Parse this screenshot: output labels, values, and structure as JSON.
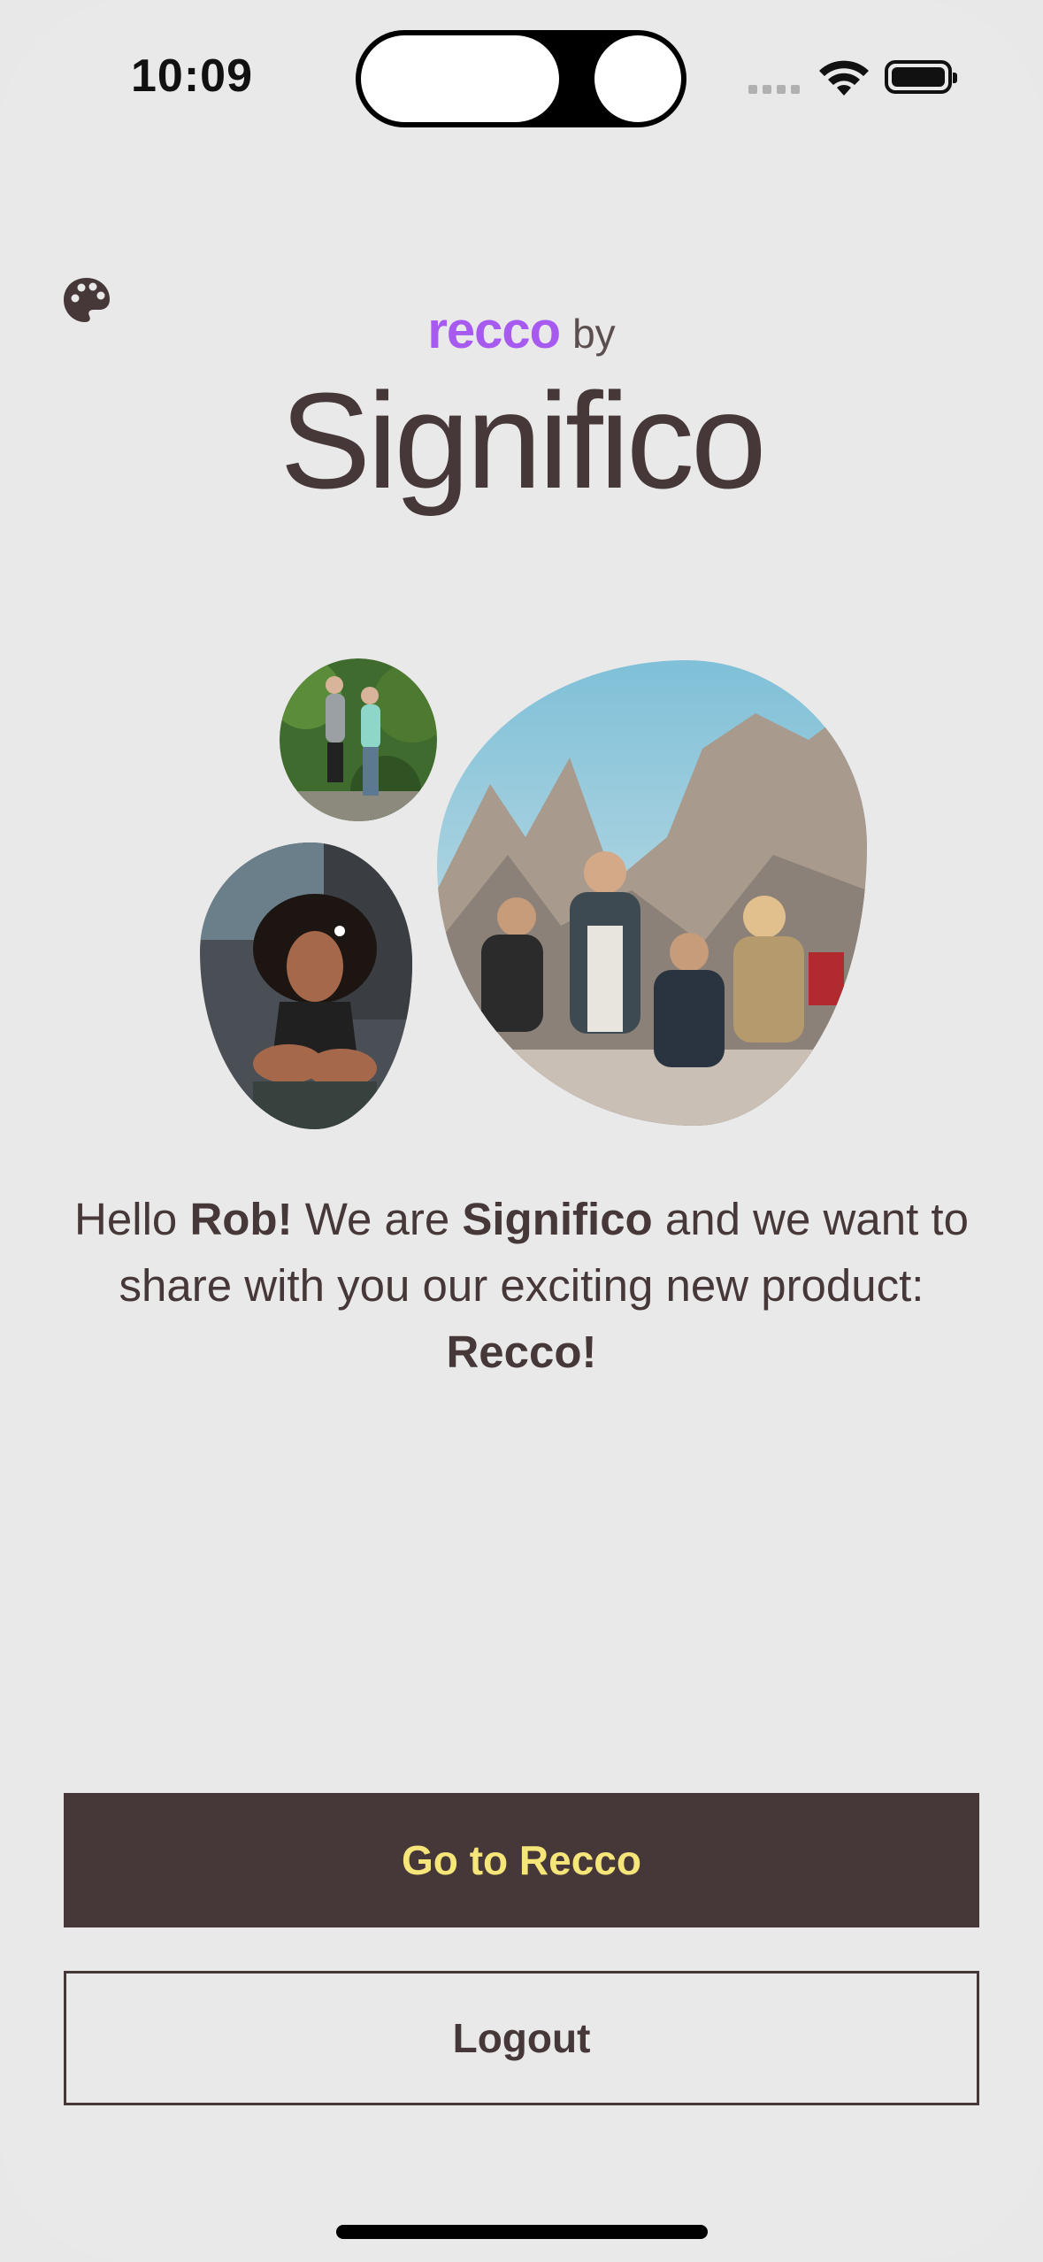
{
  "status_bar": {
    "time": "10:09",
    "icons": [
      "signal-icon",
      "wifi-icon",
      "battery-icon"
    ]
  },
  "header": {
    "theme_icon": "palette-icon",
    "brand_product": "recco",
    "brand_connector": "by",
    "brand_company": "Significo"
  },
  "hero_images": [
    "couple-doing-yoga-photo",
    "smiling-woman-photo",
    "friends-hiking-photo"
  ],
  "intro": {
    "p1": "Hello ",
    "name": "Rob!",
    "p2": " We are ",
    "company": "Significo",
    "p3": " and we want to share with you our exciting new product: ",
    "product": "Recco!"
  },
  "actions": {
    "primary_label": "Go to Recco",
    "secondary_label": "Logout"
  },
  "colors": {
    "background": "#eae9e9",
    "primary_text": "#463838",
    "recco_purple": "#a65af0",
    "button_text_accent": "#f6e67a"
  }
}
